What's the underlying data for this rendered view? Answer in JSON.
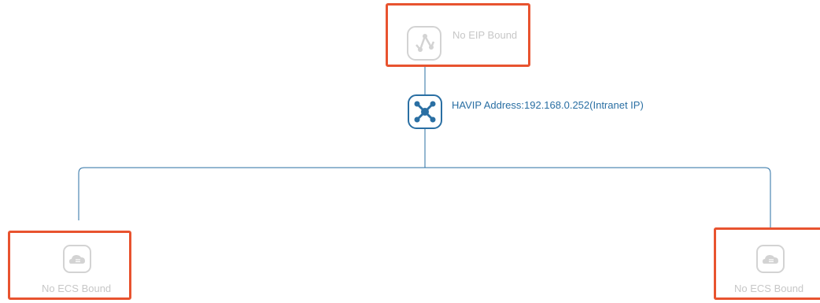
{
  "eip_node": {
    "label": "No EIP Bound",
    "icon": "eip-icon"
  },
  "havip_node": {
    "label": "HAVIP Address:192.168.0.252(Intranet IP)",
    "icon": "havip-network-icon"
  },
  "ecs_nodes": [
    {
      "label": "No ECS Bound",
      "icon": "ecs-cloud-server-icon"
    },
    {
      "label": "No ECS Bound",
      "icon": "ecs-cloud-server-icon"
    }
  ],
  "colors": {
    "highlight_border": "#e8532f",
    "connector_line": "#2a6fa3",
    "havip_icon": "#2a6fa3",
    "disabled": "#c7c7c7"
  }
}
